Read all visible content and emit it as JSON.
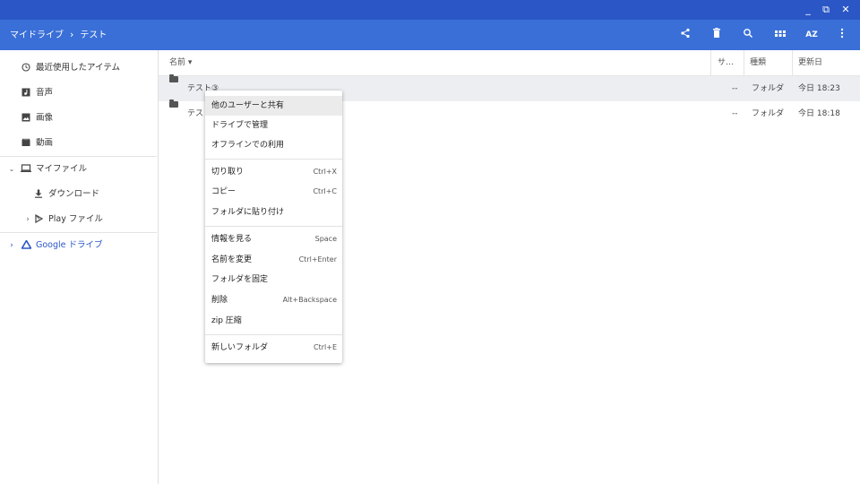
{
  "window": {
    "minimize": "_",
    "restore": "⧉",
    "close": "✕"
  },
  "toolbar": {
    "breadcrumb": [
      "マイドライブ",
      "テスト"
    ],
    "breadcrumb_sep": "›",
    "sort_label": "AZ",
    "icons": [
      "share-icon",
      "delete-icon",
      "search-icon",
      "grid-view-icon",
      "sort-icon",
      "more-icon"
    ]
  },
  "sidebar": {
    "recent": "最近使用したアイテム",
    "audio": "音声",
    "images": "画像",
    "videos": "動画",
    "my_files": "マイファイル",
    "downloads": "ダウンロード",
    "play_files": "Play ファイル",
    "google_drive": "Google ドライブ"
  },
  "table": {
    "headers": {
      "name": "名前 ▾",
      "size": "サ…",
      "type": "種類",
      "modified": "更新日"
    },
    "rows": [
      {
        "name": "テスト③",
        "size": "--",
        "type": "フォルダ",
        "modified": "今日 18:23"
      },
      {
        "name": "テスト",
        "size": "--",
        "type": "フォルダ",
        "modified": "今日 18:18"
      }
    ]
  },
  "context_menu": {
    "groups": [
      [
        {
          "label": "他のユーザーと共有",
          "shortcut": ""
        },
        {
          "label": "ドライブで管理",
          "shortcut": ""
        },
        {
          "label": "オフラインでの利用",
          "shortcut": ""
        }
      ],
      [
        {
          "label": "切り取り",
          "shortcut": "Ctrl+X"
        },
        {
          "label": "コピー",
          "shortcut": "Ctrl+C"
        },
        {
          "label": "フォルダに貼り付け",
          "shortcut": ""
        }
      ],
      [
        {
          "label": "情報を見る",
          "shortcut": "Space"
        },
        {
          "label": "名前を変更",
          "shortcut": "Ctrl+Enter"
        },
        {
          "label": "フォルダを固定",
          "shortcut": ""
        },
        {
          "label": "削除",
          "shortcut": "Alt+Backspace"
        },
        {
          "label": "zip 圧縮",
          "shortcut": ""
        }
      ],
      [
        {
          "label": "新しいフォルダ",
          "shortcut": "Ctrl+E"
        }
      ]
    ]
  },
  "colors": {
    "titlebar": "#2a56c6",
    "toolbar": "#3a6fd8",
    "selection": "#eceef2",
    "drive_blue": "#2a56c6"
  }
}
